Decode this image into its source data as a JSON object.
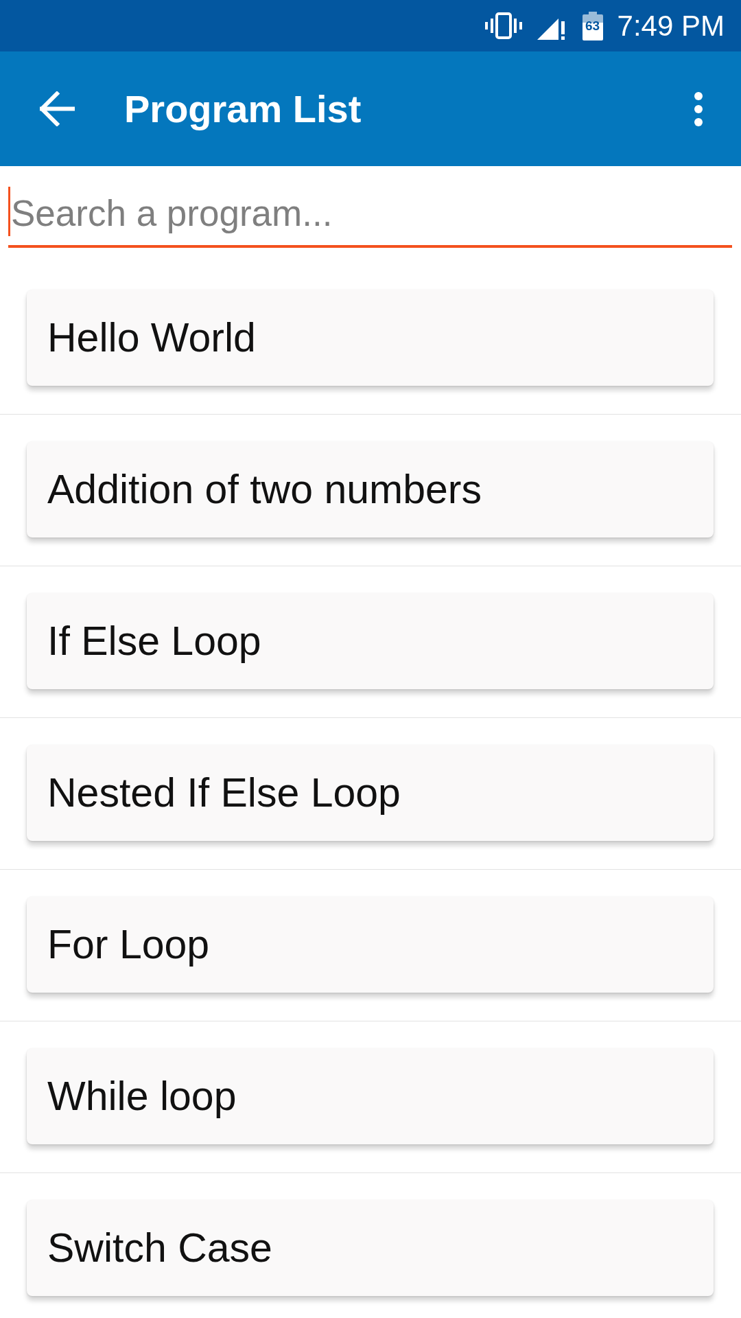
{
  "status_bar": {
    "battery_text": "63",
    "time": "7:49 PM"
  },
  "app_bar": {
    "title": "Program List"
  },
  "search": {
    "placeholder": "Search a program...",
    "focused": true
  },
  "programs": [
    "Hello World",
    "Addition of two numbers",
    "If Else Loop",
    "Nested If Else Loop",
    "For Loop",
    "While loop",
    "Switch Case"
  ]
}
